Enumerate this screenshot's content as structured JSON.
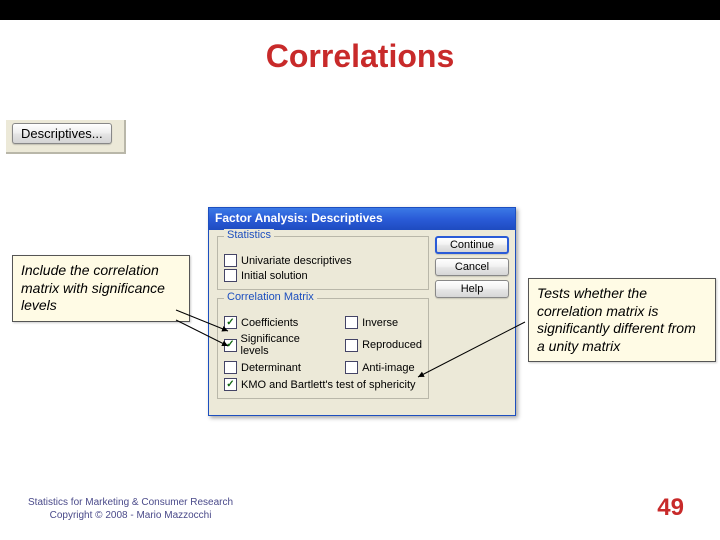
{
  "title": "Correlations",
  "descriptives_button_label": "Descriptives...",
  "note_left": "Include the correlation matrix with significance levels",
  "note_right": "Tests whether the correlation matrix is significantly different from a unity matrix",
  "dialog": {
    "title": "Factor Analysis: Descriptives",
    "statistics_group": "Statistics",
    "stat_univariate": "Univariate descriptives",
    "stat_initial": "Initial solution",
    "corr_matrix_group": "Correlation Matrix",
    "cm_coeff": "Coefficients",
    "cm_inverse": "Inverse",
    "cm_sig": "Significance levels",
    "cm_repro": "Reproduced",
    "cm_det": "Determinant",
    "cm_anti": "Anti-image",
    "cm_kmo": "KMO and Bartlett's test of sphericity",
    "btn_continue": "Continue",
    "btn_cancel": "Cancel",
    "btn_help": "Help"
  },
  "footer_line1": "Statistics for Marketing & Consumer Research",
  "footer_line2": "Copyright © 2008 - Mario Mazzocchi",
  "slide_number": "49"
}
